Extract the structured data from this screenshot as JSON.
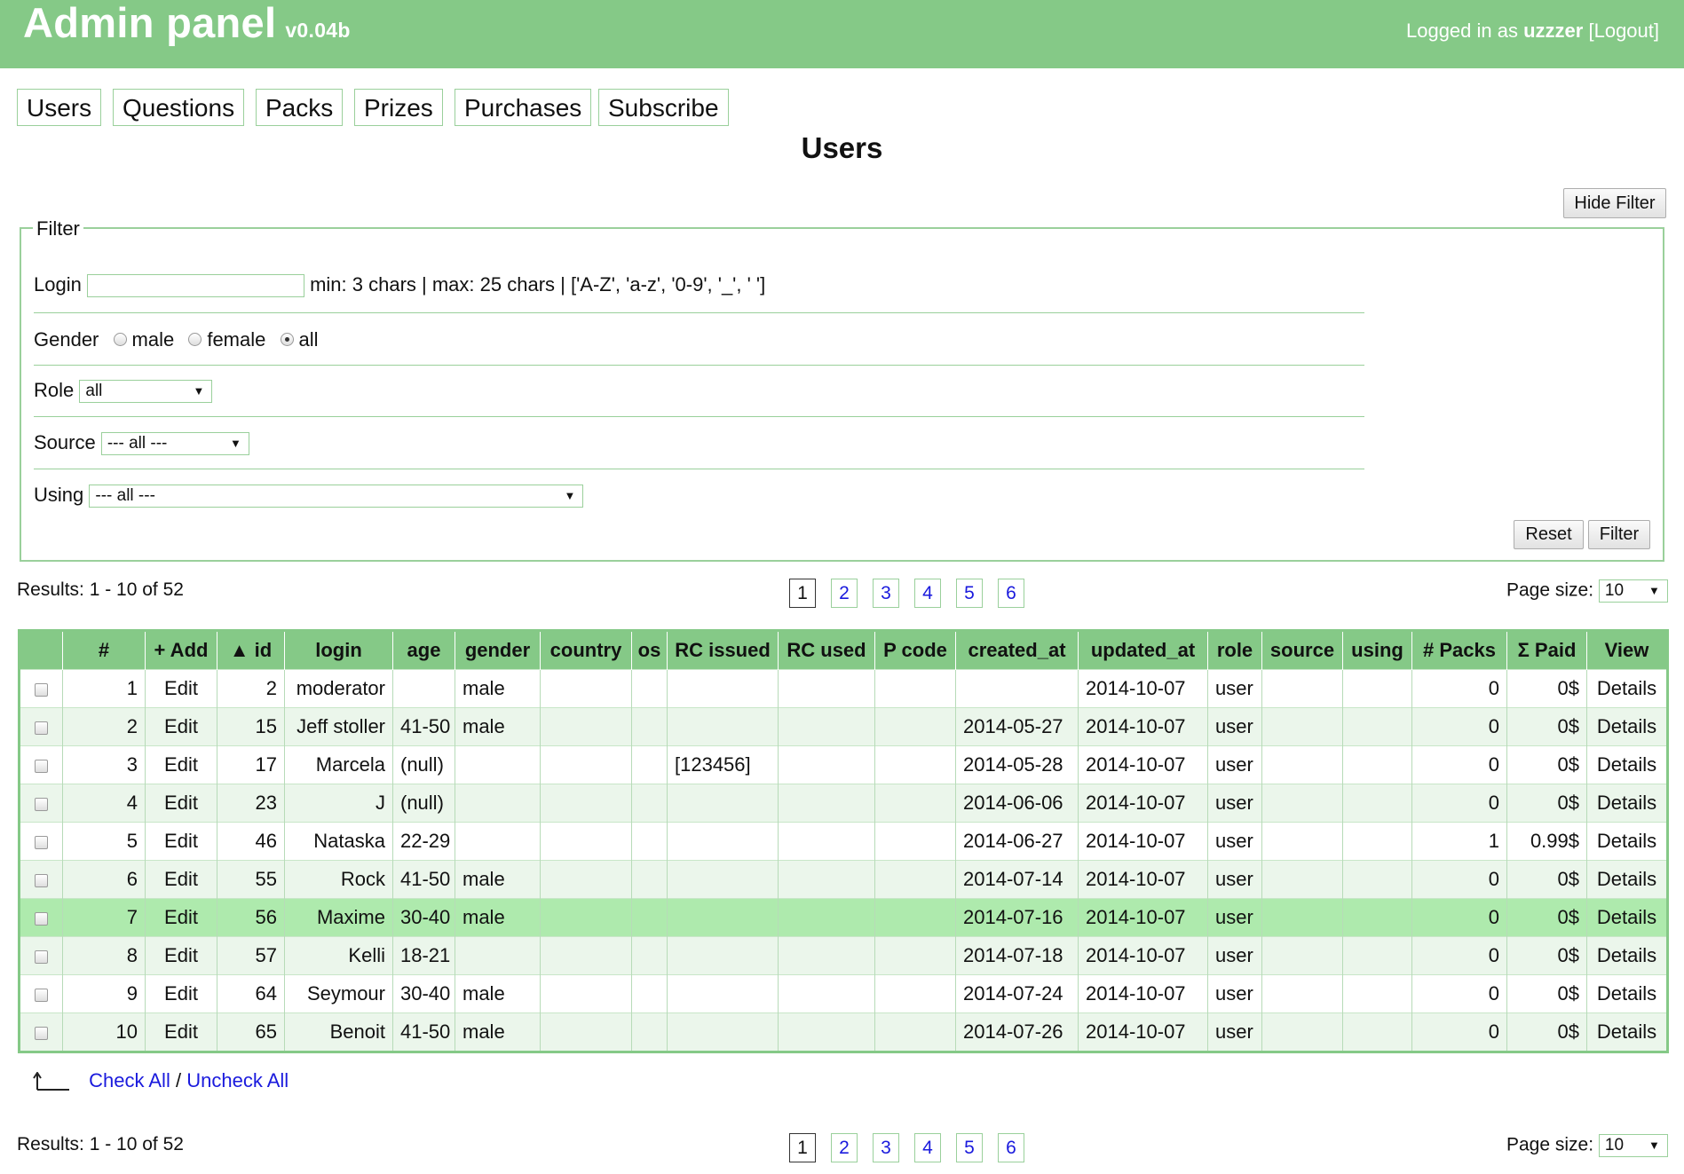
{
  "header": {
    "title": "Admin panel",
    "version": "v0.04b",
    "logged_prefix": "Logged in as",
    "username": "uzzzer",
    "logout": "[Logout]"
  },
  "nav": [
    "Users",
    "Questions",
    "Packs",
    "Prizes",
    "Purchases",
    "Subscribe"
  ],
  "page_title": "Users",
  "hide_filter": "Hide Filter",
  "filter": {
    "legend": "Filter",
    "login_label": "Login",
    "login_value": "",
    "login_hint": "min: 3 chars | max: 25 chars | ['A-Z', 'a-z', '0-9', '_', ' ']",
    "gender_label": "Gender",
    "gender_options": [
      "male",
      "female",
      "all"
    ],
    "gender_selected": "all",
    "role_label": "Role",
    "role_value": "all",
    "source_label": "Source",
    "source_value": "--- all ---",
    "using_label": "Using",
    "using_value": "--- all ---",
    "reset": "Reset",
    "submit": "Filter"
  },
  "results_text": "Results: 1 - 10 of 52",
  "pages": [
    "1",
    "2",
    "3",
    "4",
    "5",
    "6"
  ],
  "current_page": "1",
  "page_size_label": "Page size:",
  "page_size_value": "10",
  "columns": [
    "",
    "#",
    "+ Add",
    "▲ id",
    "login",
    "age",
    "gender",
    "country",
    "os",
    "RC issued",
    "RC used",
    "P code",
    "created_at",
    "updated_at",
    "role",
    "source",
    "using",
    "# Packs",
    "Σ Paid",
    "View"
  ],
  "rows": [
    {
      "n": "1",
      "edit": "Edit",
      "id": "2",
      "login": "moderator",
      "age": "",
      "gender": "male",
      "country": "",
      "os": "",
      "rc_issued": "",
      "rc_used": "",
      "p_code": "",
      "created_at": "",
      "updated_at": "2014-10-07",
      "role": "user",
      "source": "",
      "using": "",
      "packs": "0",
      "paid": "0$",
      "view": "Details"
    },
    {
      "n": "2",
      "edit": "Edit",
      "id": "15",
      "login": "Jeff stoller",
      "age": "41-50",
      "gender": "male",
      "country": "",
      "os": "",
      "rc_issued": "",
      "rc_used": "",
      "p_code": "",
      "created_at": "2014-05-27",
      "updated_at": "2014-10-07",
      "role": "user",
      "source": "",
      "using": "",
      "packs": "0",
      "paid": "0$",
      "view": "Details"
    },
    {
      "n": "3",
      "edit": "Edit",
      "id": "17",
      "login": "Marcela",
      "age": "(null)",
      "gender": "",
      "country": "",
      "os": "",
      "rc_issued": "[123456]",
      "rc_used": "",
      "p_code": "",
      "created_at": "2014-05-28",
      "updated_at": "2014-10-07",
      "role": "user",
      "source": "",
      "using": "",
      "packs": "0",
      "paid": "0$",
      "view": "Details"
    },
    {
      "n": "4",
      "edit": "Edit",
      "id": "23",
      "login": "J",
      "age": "(null)",
      "gender": "",
      "country": "",
      "os": "",
      "rc_issued": "",
      "rc_used": "",
      "p_code": "",
      "created_at": "2014-06-06",
      "updated_at": "2014-10-07",
      "role": "user",
      "source": "",
      "using": "",
      "packs": "0",
      "paid": "0$",
      "view": "Details"
    },
    {
      "n": "5",
      "edit": "Edit",
      "id": "46",
      "login": "Nataska",
      "age": "22-29",
      "gender": "",
      "country": "",
      "os": "",
      "rc_issued": "",
      "rc_used": "",
      "p_code": "",
      "created_at": "2014-06-27",
      "updated_at": "2014-10-07",
      "role": "user",
      "source": "",
      "using": "",
      "packs": "1",
      "paid": "0.99$",
      "view": "Details"
    },
    {
      "n": "6",
      "edit": "Edit",
      "id": "55",
      "login": "Rock",
      "age": "41-50",
      "gender": "male",
      "country": "",
      "os": "",
      "rc_issued": "",
      "rc_used": "",
      "p_code": "",
      "created_at": "2014-07-14",
      "updated_at": "2014-10-07",
      "role": "user",
      "source": "",
      "using": "",
      "packs": "0",
      "paid": "0$",
      "view": "Details"
    },
    {
      "n": "7",
      "edit": "Edit",
      "id": "56",
      "login": "Maxime",
      "age": "30-40",
      "gender": "male",
      "country": "",
      "os": "",
      "rc_issued": "",
      "rc_used": "",
      "p_code": "",
      "created_at": "2014-07-16",
      "updated_at": "2014-10-07",
      "role": "user",
      "source": "",
      "using": "",
      "packs": "0",
      "paid": "0$",
      "view": "Details"
    },
    {
      "n": "8",
      "edit": "Edit",
      "id": "57",
      "login": "Kelli",
      "age": "18-21",
      "gender": "",
      "country": "",
      "os": "",
      "rc_issued": "",
      "rc_used": "",
      "p_code": "",
      "created_at": "2014-07-18",
      "updated_at": "2014-10-07",
      "role": "user",
      "source": "",
      "using": "",
      "packs": "0",
      "paid": "0$",
      "view": "Details"
    },
    {
      "n": "9",
      "edit": "Edit",
      "id": "64",
      "login": "Seymour",
      "age": "30-40",
      "gender": "male",
      "country": "",
      "os": "",
      "rc_issued": "",
      "rc_used": "",
      "p_code": "",
      "created_at": "2014-07-24",
      "updated_at": "2014-10-07",
      "role": "user",
      "source": "",
      "using": "",
      "packs": "0",
      "paid": "0$",
      "view": "Details"
    },
    {
      "n": "10",
      "edit": "Edit",
      "id": "65",
      "login": "Benoit",
      "age": "41-50",
      "gender": "male",
      "country": "",
      "os": "",
      "rc_issued": "",
      "rc_used": "",
      "p_code": "",
      "created_at": "2014-07-26",
      "updated_at": "2014-10-07",
      "role": "user",
      "source": "",
      "using": "",
      "packs": "0",
      "paid": "0$",
      "view": "Details"
    }
  ],
  "highlighted_row": "7",
  "check_all": "Check All",
  "separator": "/",
  "uncheck_all": "Uncheck All"
}
